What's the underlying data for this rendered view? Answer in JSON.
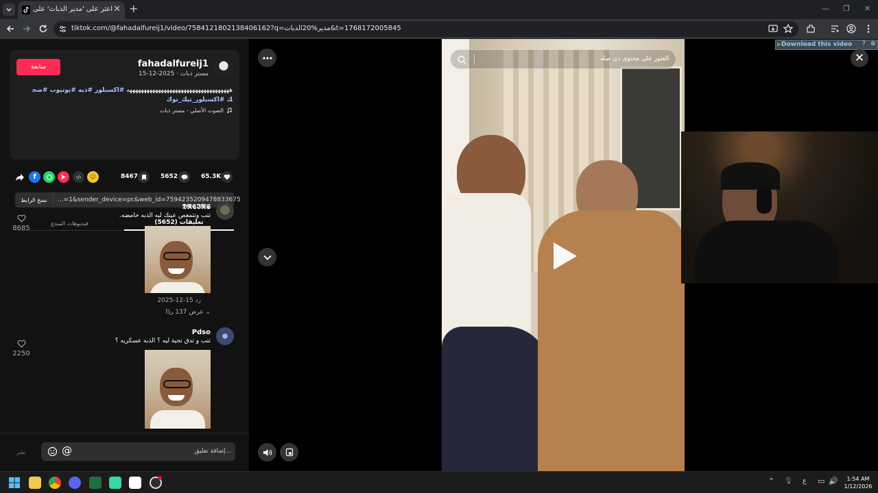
{
  "browser": {
    "tab_title": "اعثر على 'مدير الذبات' على TikTok",
    "url": "tiktok.com/@fahadalfureij1/video/7584121802138406162?q=مدير%20الذبات&t=1768172005845"
  },
  "author": {
    "follow_label": "متابعة",
    "username": "fahadalfureij1",
    "subline": "مستر ذبات · 2025-12-15",
    "caption_text": "ههههههههههههههههههههههههههههههههههههه",
    "caption_tags": "#اكسبلور #ذبه #يوتيوب #ضحك #اكسبلور_تيك_توك",
    "sound": "الصوت الأصلي - مستر ذبات"
  },
  "actions": {
    "likes": "65.3K",
    "comments": "5652",
    "saves": "8467"
  },
  "link": {
    "copy_label": "نسخ الرابط",
    "url": "...=1&sender_device=pc&web_id=7594235209478833675"
  },
  "tabs": {
    "comments": "تعليقات (5652)",
    "creator_videos": "فيديوهات المبدع"
  },
  "comments": [
    {
      "user": "𝕯𝕽𝕮𝕴𝕽𝕾",
      "text": "تتب وتتمعص عينك ليه الذبه حامضه.",
      "likes": "8685",
      "date": "2025-12-15",
      "reply_label": "رد",
      "view_replies": "عرض 137 ردًا"
    },
    {
      "user": "Pdso",
      "text": "تتب و تدق تحية ليه ؟ الذبه عسكريه ؟",
      "likes": "2250"
    }
  ],
  "composer": {
    "placeholder": "إضافة تعليق...",
    "post_label": "نشر"
  },
  "video": {
    "search_placeholder": "العثور على محتوى ذي صلة",
    "download_banner": "Download this video"
  },
  "taskbar": {
    "time": "1:54 AM",
    "date": "1/12/2026",
    "lang": "ع"
  },
  "colors": {
    "accent": "#fe2c55",
    "hashtag": "#a8c7ff"
  }
}
